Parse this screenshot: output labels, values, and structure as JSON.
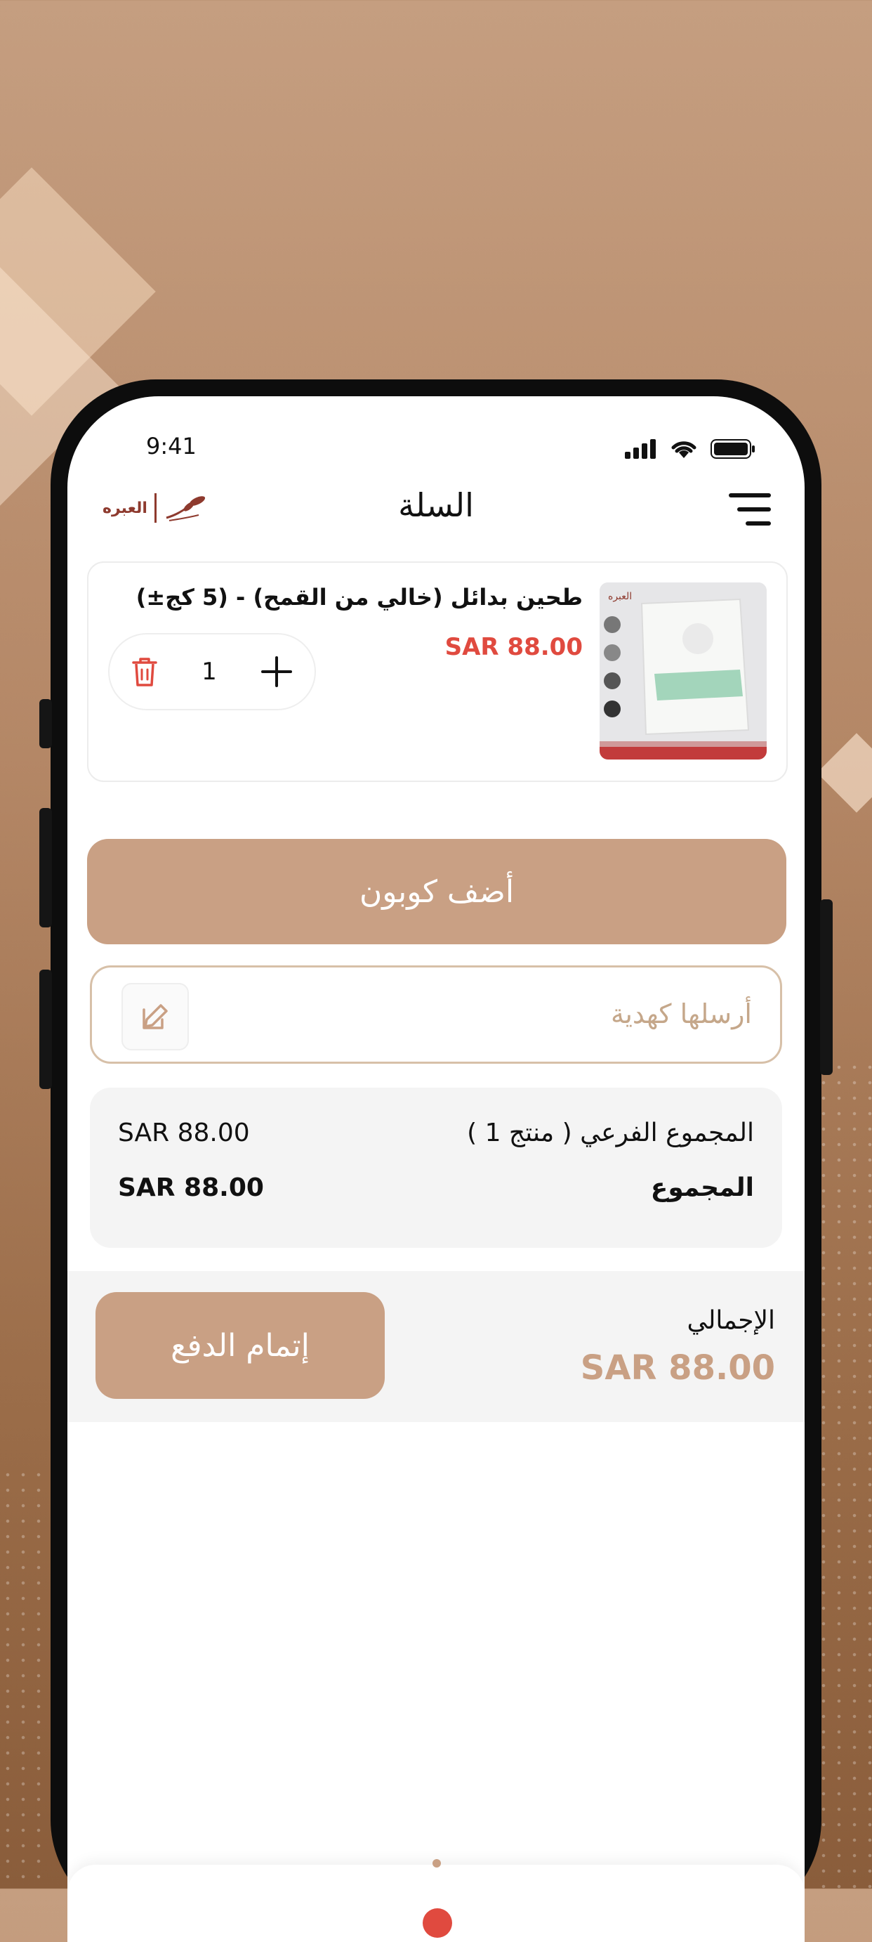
{
  "status_bar": {
    "time": "9:41"
  },
  "header": {
    "title": "السلة",
    "logo_text": "العبره"
  },
  "cart": {
    "items": [
      {
        "name": "طحين بدائل (خالي من القمح) - (5 كج±)",
        "price": "SAR 88.00",
        "quantity": "1"
      }
    ]
  },
  "coupon": {
    "label": "أضف كوبون"
  },
  "gift": {
    "placeholder": "أرسلها كهدية"
  },
  "summary": {
    "subtotal_label": "المجموع الفرعي ( منتج 1 )",
    "subtotal_value": "SAR 88.00",
    "total_label": "المجموع",
    "total_value": "SAR 88.00"
  },
  "checkout": {
    "grand_total_label": "الإجمالي",
    "grand_total_value": "SAR 88.00",
    "pay_button": "إتمام الدفع"
  },
  "colors": {
    "accent": "#c9a084",
    "price_red": "#e04a3f",
    "background": "#b48766"
  },
  "icons": [
    "menu-icon",
    "trash-icon",
    "plus-icon",
    "edit-icon",
    "signal-icon",
    "wifi-icon",
    "battery-icon"
  ]
}
